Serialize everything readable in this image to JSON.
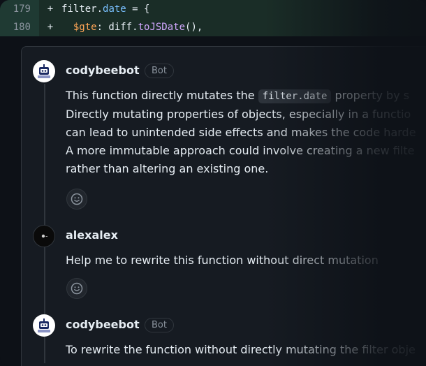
{
  "diff": {
    "lines": [
      {
        "number": "179",
        "sign": "+",
        "indent": "  ",
        "parts": [
          "filter.",
          "date",
          " = {"
        ]
      },
      {
        "number": "180",
        "sign": "+",
        "indent": "    ",
        "parts": [
          "$gte",
          ": diff.",
          "toJSDate",
          "(),"
        ]
      }
    ]
  },
  "comments": [
    {
      "author": "codybeebot",
      "badge": "Bot",
      "text_before_code": "This function directly mutates the ",
      "inline_code": "filter.date",
      "text_after_code": " property by s",
      "lines": [
        "Directly mutating properties of objects, especially in a functio",
        "can lead to unintended side effects and makes the code harde",
        "A more immutable approach could involve creating a new filte",
        "rather than altering an existing one."
      ]
    },
    {
      "author": "alexalex",
      "text": "Help me to rewrite this function without direct mutation"
    },
    {
      "author": "codybeebot",
      "badge": "Bot",
      "text": "To rewrite the function without directly mutating the filter obje"
    }
  ],
  "icons": {
    "reaction": "smiley-icon",
    "bot_avatar": "robot-avatar",
    "user_avatar": "user-avatar"
  }
}
